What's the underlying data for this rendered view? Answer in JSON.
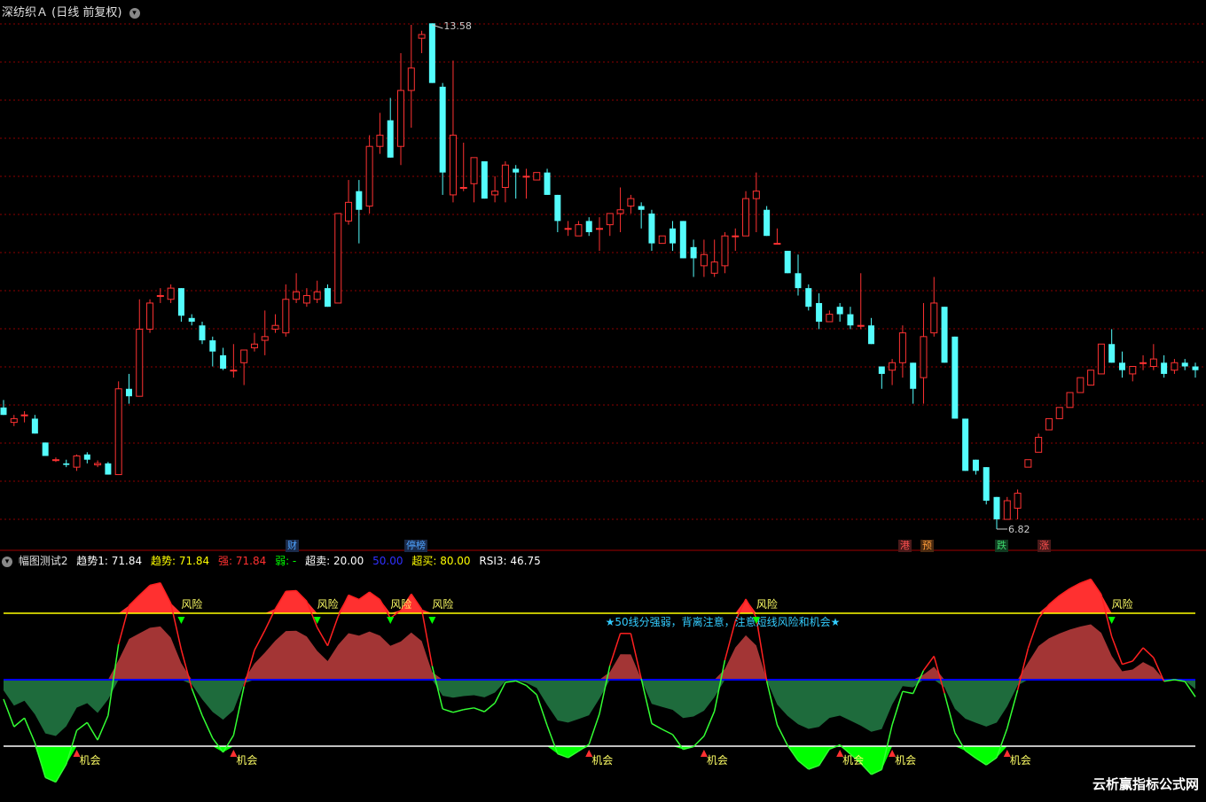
{
  "header": {
    "title": "深纺织Ａ (日线 前复权)",
    "high_label": "13.58",
    "low_label": "6.82"
  },
  "event_tags": [
    {
      "text": "财",
      "color": "#4fa3ff"
    },
    {
      "text": "停榜",
      "color": "#4fa3ff"
    },
    {
      "text": "港",
      "color": "#ff5050"
    },
    {
      "text": "预",
      "color": "#ff9c3a"
    },
    {
      "text": "跌",
      "color": "#3cd66b"
    },
    {
      "text": "涨",
      "color": "#ff5050"
    }
  ],
  "indicator": {
    "name": "幅图测试2",
    "trend1": "趋势1: 71.84",
    "trend": "趋势: 71.84",
    "strong": "强: 71.84",
    "weak": "弱: -",
    "oversold": "超卖: 20.00",
    "mid": "50.00",
    "overbought": "超买: 80.00",
    "rsi3": "RSI3: 46.75",
    "note": "★50线分强弱，背离注意，注意短线风险和机会★",
    "risk_label": "风险",
    "chance_label": "机会",
    "colors": {
      "trend1": "#ffffff",
      "trend": "#ffff00",
      "strong": "#ff3030",
      "weak": "#00ff00",
      "oversold": "#ffffff",
      "mid": "#0000ff",
      "overbought": "#ffff00",
      "rsi3": "#ffffff"
    }
  },
  "watermark": "云析赢指标公式网",
  "colors": {
    "up": "#ff3232",
    "down": "#54fcfc",
    "bg": "#000000",
    "grid": "#8b0000"
  },
  "chart_data": {
    "type": "candlestick",
    "high": 13.58,
    "low": 6.82,
    "candles": [
      [
        8.45,
        8.55,
        8.35,
        8.35
      ],
      [
        8.25,
        8.35,
        8.2,
        8.3
      ],
      [
        8.35,
        8.4,
        8.25,
        8.35
      ],
      [
        8.3,
        8.35,
        8.1,
        8.1
      ],
      [
        7.98,
        7.98,
        7.8,
        7.8
      ],
      [
        7.75,
        7.78,
        7.72,
        7.75
      ],
      [
        7.7,
        7.75,
        7.65,
        7.68
      ],
      [
        7.65,
        7.82,
        7.6,
        7.8
      ],
      [
        7.82,
        7.85,
        7.7,
        7.75
      ],
      [
        7.68,
        7.74,
        7.65,
        7.7
      ],
      [
        7.7,
        7.72,
        7.55,
        7.55
      ],
      [
        7.55,
        8.8,
        7.55,
        8.7
      ],
      [
        8.7,
        8.9,
        8.5,
        8.6
      ],
      [
        8.6,
        9.9,
        8.6,
        9.5
      ],
      [
        9.5,
        9.9,
        9.45,
        9.85
      ],
      [
        9.95,
        10.05,
        9.85,
        9.95
      ],
      [
        9.9,
        10.1,
        9.85,
        10.05
      ],
      [
        10.05,
        10.05,
        9.6,
        9.68
      ],
      [
        9.65,
        9.7,
        9.55,
        9.6
      ],
      [
        9.55,
        9.6,
        9.3,
        9.35
      ],
      [
        9.35,
        9.4,
        9.0,
        9.2
      ],
      [
        9.15,
        9.25,
        8.95,
        8.97
      ],
      [
        8.95,
        9.3,
        8.85,
        8.95
      ],
      [
        9.05,
        9.2,
        8.75,
        9.22
      ],
      [
        9.25,
        9.45,
        9.2,
        9.3
      ],
      [
        9.35,
        9.75,
        9.15,
        9.4
      ],
      [
        9.5,
        9.7,
        9.45,
        9.55
      ],
      [
        9.45,
        10.1,
        9.4,
        9.9
      ],
      [
        9.9,
        10.25,
        9.85,
        10.0
      ],
      [
        9.85,
        10.05,
        9.8,
        9.95
      ],
      [
        9.9,
        10.15,
        9.85,
        10.0
      ],
      [
        10.05,
        10.1,
        9.8,
        9.8
      ],
      [
        9.85,
        11.05,
        9.85,
        11.05
      ],
      [
        10.95,
        11.5,
        10.9,
        11.2
      ],
      [
        11.35,
        11.5,
        10.65,
        11.1
      ],
      [
        11.15,
        12.1,
        11.05,
        11.95
      ],
      [
        11.95,
        12.4,
        11.85,
        12.1
      ],
      [
        12.3,
        12.6,
        11.8,
        11.8
      ],
      [
        11.95,
        13.2,
        11.7,
        12.7
      ],
      [
        12.7,
        13.58,
        12.2,
        13.0
      ],
      [
        13.4,
        13.5,
        13.2,
        13.45
      ],
      [
        13.6,
        13.6,
        12.8,
        12.8
      ],
      [
        12.75,
        12.8,
        11.3,
        11.6
      ],
      [
        11.3,
        13.1,
        11.2,
        12.1
      ],
      [
        11.4,
        12.0,
        11.35,
        11.4
      ],
      [
        11.45,
        11.8,
        11.2,
        11.8
      ],
      [
        11.75,
        11.75,
        11.3,
        11.25
      ],
      [
        11.3,
        11.55,
        11.2,
        11.35
      ],
      [
        11.4,
        11.75,
        11.2,
        11.7
      ],
      [
        11.65,
        11.7,
        11.25,
        11.6
      ],
      [
        11.55,
        11.65,
        11.25,
        11.55
      ],
      [
        11.5,
        11.6,
        11.55,
        11.6
      ],
      [
        11.6,
        11.65,
        11.3,
        11.3
      ],
      [
        11.3,
        11.3,
        10.8,
        10.95
      ],
      [
        10.85,
        10.95,
        10.75,
        10.85
      ],
      [
        10.75,
        10.95,
        10.8,
        10.9
      ],
      [
        10.95,
        11.0,
        10.75,
        10.8
      ],
      [
        10.85,
        11.0,
        10.55,
        10.85
      ],
      [
        10.9,
        11.05,
        10.75,
        11.05
      ],
      [
        11.05,
        11.4,
        10.8,
        11.1
      ],
      [
        11.15,
        11.3,
        11.05,
        11.25
      ],
      [
        11.15,
        11.2,
        10.85,
        11.1
      ],
      [
        11.05,
        11.1,
        10.55,
        10.65
      ],
      [
        10.65,
        10.65,
        10.75,
        10.75
      ],
      [
        10.85,
        10.95,
        10.55,
        10.65
      ],
      [
        10.95,
        10.95,
        10.45,
        10.45
      ],
      [
        10.6,
        10.7,
        10.2,
        10.45
      ],
      [
        10.35,
        10.7,
        10.2,
        10.5
      ],
      [
        10.25,
        10.7,
        10.2,
        10.4
      ],
      [
        10.35,
        10.8,
        10.25,
        10.75
      ],
      [
        10.75,
        10.85,
        10.55,
        10.75
      ],
      [
        10.75,
        11.35,
        10.75,
        11.25
      ],
      [
        11.25,
        11.6,
        10.8,
        11.35
      ],
      [
        11.1,
        11.15,
        10.75,
        10.75
      ],
      [
        10.65,
        10.85,
        10.65,
        10.65
      ],
      [
        10.55,
        10.55,
        10.25,
        10.25
      ],
      [
        10.25,
        10.5,
        9.95,
        10.05
      ],
      [
        10.05,
        10.1,
        9.75,
        9.8
      ],
      [
        9.85,
        9.98,
        9.5,
        9.6
      ],
      [
        9.6,
        9.75,
        9.6,
        9.7
      ],
      [
        9.8,
        9.85,
        9.6,
        9.7
      ],
      [
        9.7,
        9.8,
        9.5,
        9.55
      ],
      [
        9.55,
        10.25,
        9.5,
        9.55
      ],
      [
        9.55,
        9.65,
        9.3,
        9.3
      ],
      [
        9.0,
        9.0,
        8.7,
        8.9
      ],
      [
        8.95,
        9.1,
        8.75,
        9.05
      ],
      [
        9.05,
        9.55,
        8.85,
        9.45
      ],
      [
        9.05,
        9.05,
        8.5,
        8.7
      ],
      [
        8.85,
        9.85,
        8.5,
        9.4
      ],
      [
        9.45,
        10.2,
        9.4,
        9.85
      ],
      [
        9.8,
        9.8,
        9.05,
        9.05
      ],
      [
        9.4,
        9.4,
        8.3,
        8.3
      ],
      [
        8.3,
        8.3,
        8.0,
        7.6
      ],
      [
        7.75,
        7.75,
        7.55,
        7.6
      ],
      [
        7.65,
        7.65,
        7.15,
        7.2
      ],
      [
        7.25,
        7.25,
        6.82,
        6.95
      ],
      [
        6.95,
        7.25,
        6.95,
        7.2
      ],
      [
        7.1,
        7.35,
        6.95,
        7.3
      ],
      [
        7.65,
        7.65,
        7.8,
        7.75
      ],
      [
        7.85,
        8.1,
        7.85,
        8.05
      ],
      [
        8.15,
        8.15,
        8.35,
        8.3
      ],
      [
        8.3,
        8.35,
        8.5,
        8.45
      ],
      [
        8.45,
        8.5,
        8.7,
        8.65
      ],
      [
        8.65,
        8.75,
        8.85,
        8.85
      ],
      [
        8.75,
        8.9,
        8.95,
        8.95
      ],
      [
        8.9,
        9.3,
        8.95,
        9.3
      ],
      [
        9.3,
        9.5,
        9.05,
        9.05
      ],
      [
        9.05,
        9.2,
        8.85,
        8.95
      ],
      [
        8.9,
        9.0,
        8.8,
        9.0
      ],
      [
        9.05,
        9.15,
        8.95,
        9.05
      ],
      [
        9.0,
        9.3,
        8.95,
        9.1
      ],
      [
        9.05,
        9.15,
        8.85,
        8.9
      ],
      [
        8.95,
        9.1,
        8.9,
        9.05
      ],
      [
        9.05,
        9.1,
        8.95,
        9.0
      ],
      [
        9.0,
        9.05,
        8.85,
        8.95
      ]
    ],
    "indicator_series": {
      "ylim": [
        0,
        100
      ],
      "levels": {
        "overbought": 80,
        "mid": 50,
        "oversold": 20
      }
    }
  }
}
